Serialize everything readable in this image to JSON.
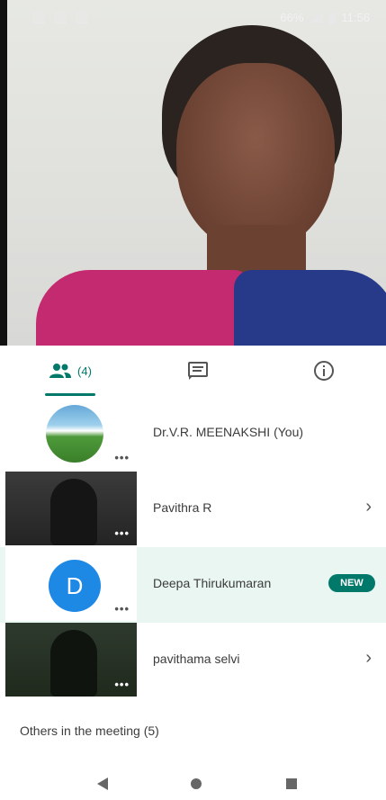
{
  "status_bar": {
    "time": "11:56",
    "battery_label": "66%"
  },
  "tabs": [
    {
      "id": "people",
      "label": "(4)",
      "icon": "people-icon",
      "active": true
    },
    {
      "id": "chat",
      "label": "",
      "icon": "chat-icon",
      "active": false
    },
    {
      "id": "info",
      "label": "",
      "icon": "info-icon",
      "active": false
    }
  ],
  "participants": [
    {
      "name": "Dr.V.R. MEENAKSHI (You)",
      "thumb": "avatar-photo",
      "trailing": ""
    },
    {
      "name": "Pavithra R",
      "thumb": "video",
      "trailing": "chevron"
    },
    {
      "name": "Deepa Thirukumaran",
      "thumb": "letter",
      "avatar_letter": "D",
      "trailing": "NEW"
    },
    {
      "name": "pavithama selvi",
      "thumb": "video",
      "trailing": "chevron"
    }
  ],
  "others_section": {
    "label": "Others in the meeting (5)"
  },
  "colors": {
    "accent": "#00796b",
    "avatar_blue": "#1e88e5",
    "highlight_row": "#e9f6f2"
  }
}
